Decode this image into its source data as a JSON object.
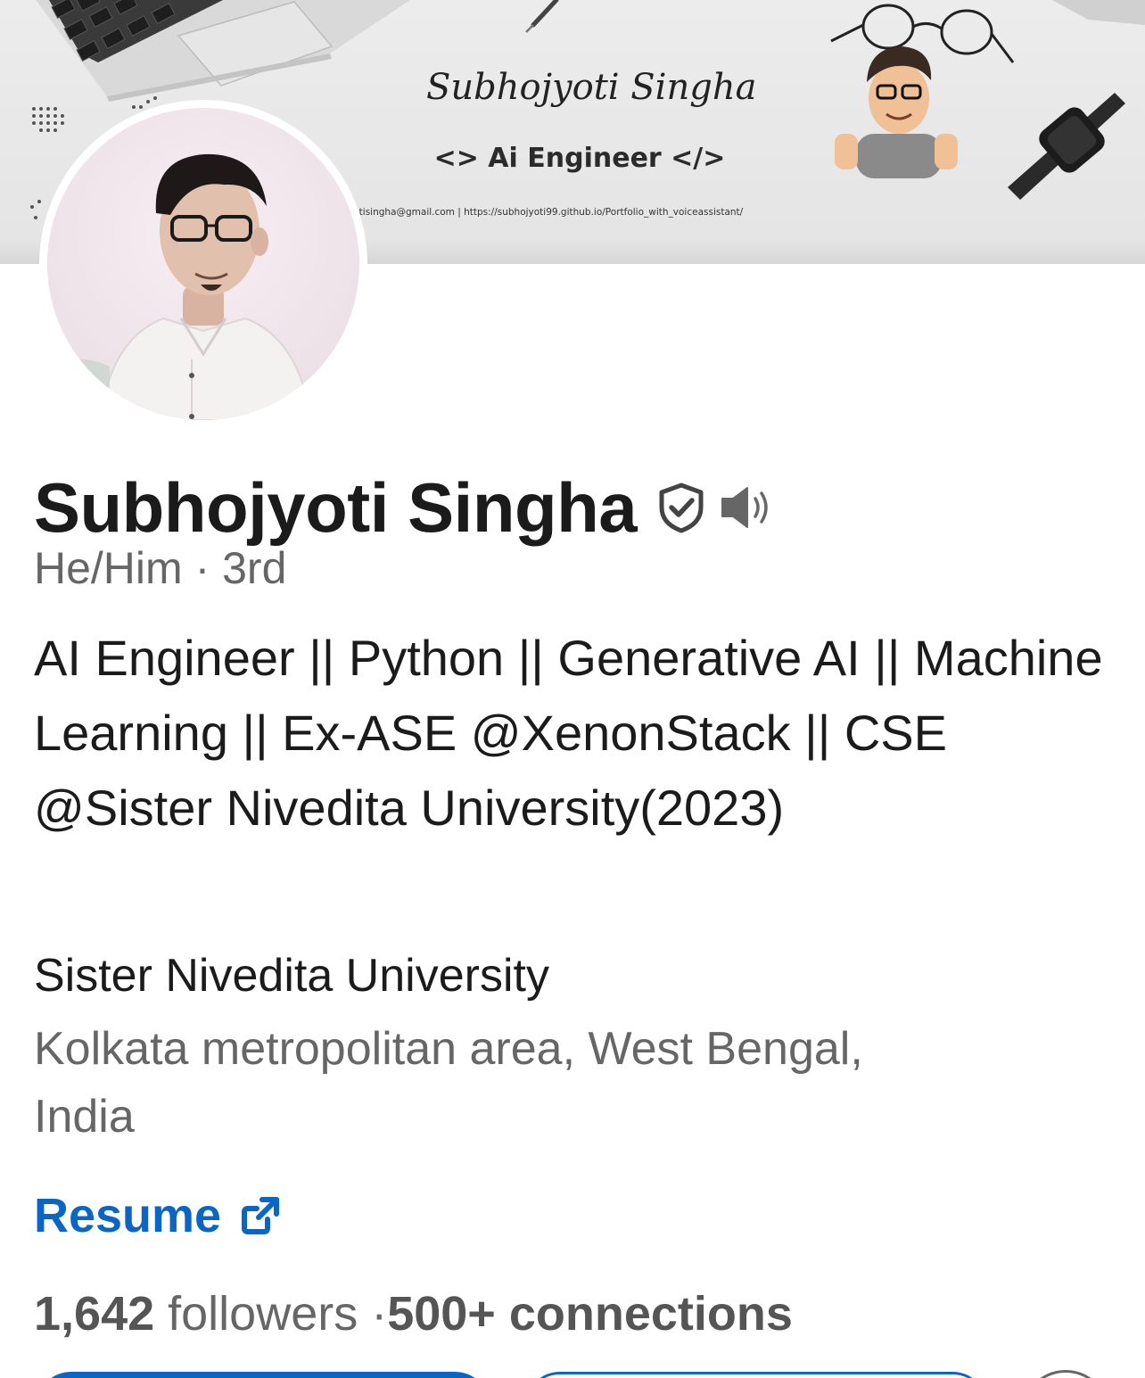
{
  "banner": {
    "signature": "Subhojyoti Singha",
    "role": "<> Ai Engineer </>",
    "contact": "ntisingha@gmail.com | https://subhojyoti99.github.io/Portfolio_with_voiceassistant/"
  },
  "profile": {
    "name": "Subhojyoti Singha",
    "pronouns_degree": "He/Him · 3rd",
    "headline": "AI Engineer || Python || Generative AI || Machine Learning || Ex-ASE @XenonStack || CSE @Sister Nivedita University(2023)",
    "school": "Sister Nivedita University",
    "location": "Kolkata metropolitan area, West Bengal, India",
    "resume_label": "Resume",
    "followers_count": "1,642",
    "followers_label": " followers ·",
    "connections": "500+ connections"
  },
  "colors": {
    "link_blue": "#0a66c2",
    "text_primary": "#1b1b1b",
    "text_secondary": "#666666"
  },
  "icons": {
    "verify": "shield-check-icon",
    "pronunciation": "speaker-icon",
    "resume_external": "external-link-icon"
  }
}
